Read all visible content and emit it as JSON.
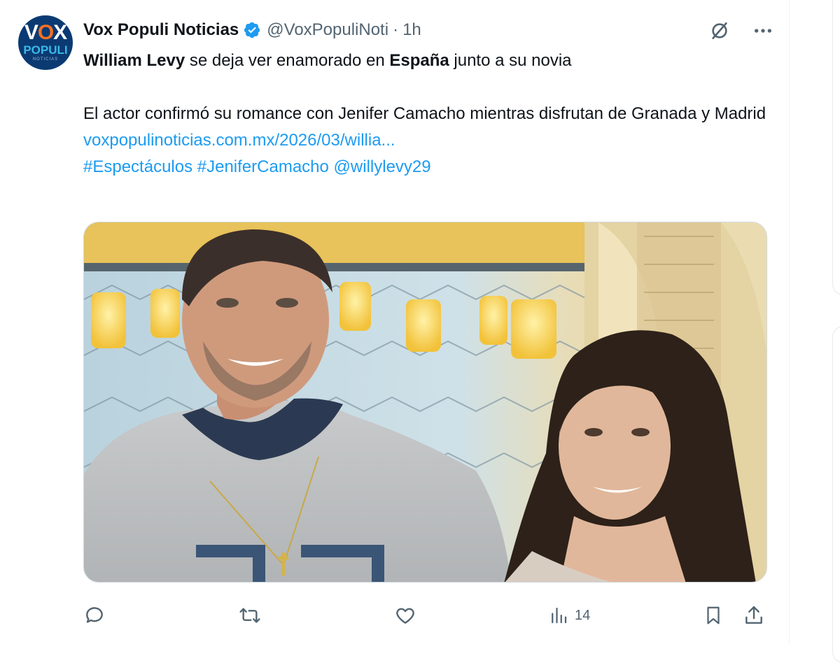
{
  "author": {
    "display_name": "Vox Populi Noticias",
    "handle": "@VoxPopuliNoti",
    "time": "1h",
    "separator": "·",
    "avatar": {
      "vox": "VOX",
      "populi": "POPULI",
      "subtitle": "NOTICIAS"
    }
  },
  "tweet": {
    "line1_bold_a": "William Levy",
    "line1_mid": " se deja ver enamorado en ",
    "line1_bold_b": "España",
    "line1_end": " junto a su novia",
    "paragraph": "El actor confirmó su romance con Jenifer Camacho mientras disfrutan de Granada y Madrid",
    "url": "voxpopulinoticias.com.mx/2026/03/willia...",
    "hashtag1": "#Espectáculos",
    "hashtag2": "#JeniferCamacho",
    "mention": "@willylevy29"
  },
  "metrics": {
    "views": "14"
  },
  "icons": [
    "grok-icon",
    "more-icon",
    "reply-icon",
    "retweet-icon",
    "like-icon",
    "views-icon",
    "bookmark-icon",
    "share-icon",
    "verified-badge-icon"
  ],
  "colors": {
    "link": "#1d9bf0",
    "verified": "#1d9bf0",
    "secondary_text": "#536471"
  }
}
